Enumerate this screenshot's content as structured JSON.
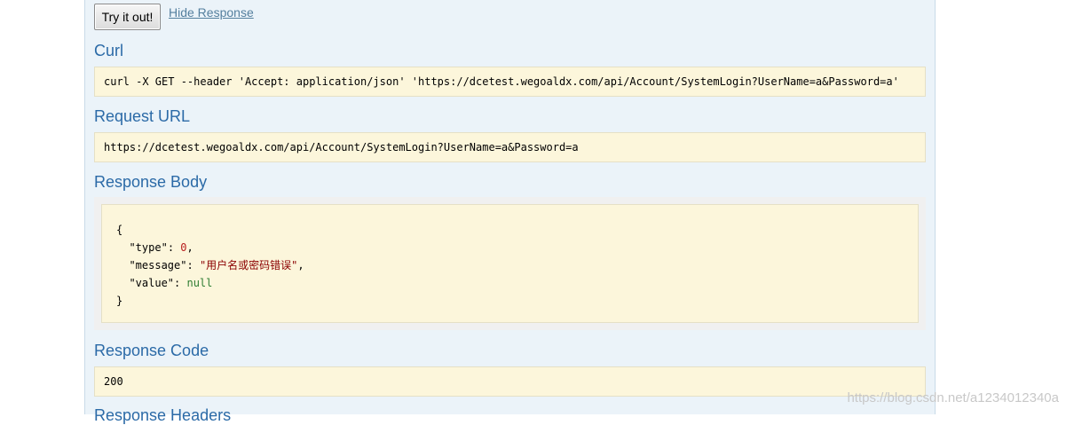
{
  "try_button": "Try it out!",
  "hide_link": "Hide Response",
  "curl": {
    "heading": "Curl",
    "command": "curl -X GET --header 'Accept: application/json' 'https://dcetest.wegoaldx.com/api/Account/SystemLogin?UserName=a&Password=a'"
  },
  "request_url": {
    "heading": "Request URL",
    "value": "https://dcetest.wegoaldx.com/api/Account/SystemLogin?UserName=a&Password=a"
  },
  "response_body": {
    "heading": "Response Body",
    "open_brace": "{",
    "close_brace": "}",
    "type_key": "\"type\"",
    "type_value": "0",
    "message_key": "\"message\"",
    "message_value": "\"用户名或密码错误\"",
    "value_key": "\"value\"",
    "value_value": "null"
  },
  "response_code": {
    "heading": "Response Code",
    "value": "200"
  },
  "next_heading_partial": "Response Headers",
  "watermark": "https://blog.csdn.net/a1234012340a",
  "colors": {
    "heading": "#2b6aa7",
    "link": "#547f9e",
    "box_bg": "#fcf6db",
    "panel_bg": "#ebf3f9",
    "string": "#8b0000",
    "number": "#b71c1c",
    "null": "#2e7d32"
  }
}
